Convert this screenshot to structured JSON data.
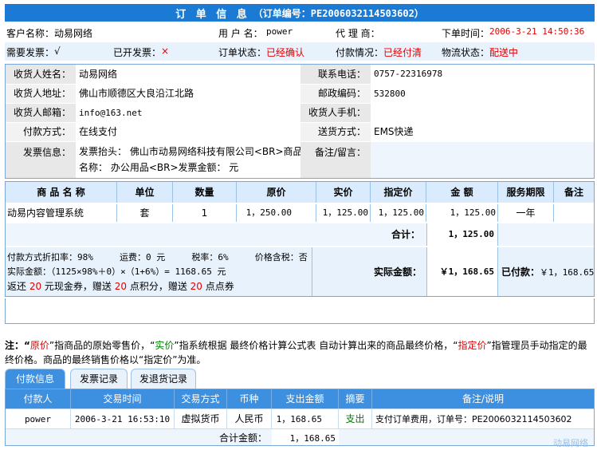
{
  "title": {
    "main": "订 单 信 息",
    "order_no": "（订单编号：PE2006032114503602）"
  },
  "header": {
    "customer_label": "客户名称：",
    "customer": "动易网络",
    "username_label": "用 户 名：",
    "username": "power",
    "agent_label": "代 理 商：",
    "agent": "",
    "time_label": "下单时间：",
    "time": "2006-3-21 14:50:36",
    "invoice_need_label": "需要发票：",
    "invoice_need": "√",
    "invoiced_label": "已开发票：",
    "invoiced": "×",
    "order_status_label": "订单状态：",
    "order_status": "已经确认",
    "payment_label": "付款情况：",
    "payment": "已经付清",
    "logistics_label": "物流状态：",
    "logistics": "配送中"
  },
  "shipping": {
    "name_label": "收货人姓名：",
    "name": "动易网络",
    "phone_label": "联系电话：",
    "phone": "0757-22316978",
    "address_label": "收货人地址：",
    "address": "佛山市顺德区大良沿江北路",
    "zip_label": "邮政编码：",
    "zip": "532800",
    "email_label": "收货人邮箱：",
    "email": "info@163.net",
    "mobile_label": "收货人手机：",
    "mobile": "",
    "pay_method_label": "付款方式：",
    "pay_method": "在线支付",
    "ship_method_label": "送货方式：",
    "ship_method": "EMS快递",
    "invoice_info_label": "发票信息：",
    "invoice_info_1": "发票抬头：  佛山市动易网络科技有限公司<BR>商品",
    "invoice_info_2": "名称：  办公用品<BR>发票金额：  元",
    "remark_label": "备注/留言：",
    "remark": ""
  },
  "products": {
    "headers": [
      "商 品 名 称",
      "单位",
      "数量",
      "原价",
      "实价",
      "指定价",
      "金 额",
      "服务期限",
      "备注"
    ],
    "row": [
      "动易内容管理系统",
      "套",
      "1",
      "1，250.00",
      "1，125.00",
      "1，125.00",
      "1，125.00",
      "一年",
      ""
    ],
    "total_label": "合计：",
    "total": "1，125.00",
    "calc_line1": "付款方式折扣率：98%     运费：0 元     税率：6%     价格含税：否",
    "calc_line2": "实际金额：（1125×98%＋0）×（1+6%）= 1168.65 元",
    "calc_line3_a": "返还 ",
    "calc_line3_b": "20",
    "calc_line3_c": " 元现金券，赠送 ",
    "calc_line3_d": "20",
    "calc_line3_e": " 点积分，赠送 ",
    "calc_line3_f": "20",
    "calc_line3_g": " 点点券",
    "actual_label": "实际金额：",
    "actual": "￥1，168.65",
    "paid_label": "已付款：",
    "paid": "￥1，168.65"
  },
  "note": {
    "a": "注：“",
    "b": "原价",
    "c": "”指商品的原始零售价，“",
    "d": "实价",
    "e": "”指系统根据 最终价格计算公式表 自动计算出来的商品最终价格，“",
    "f": "指定价",
    "g": "”指管理员手动指定的最终价格。商品的最终销售价格以“指定价”为准。"
  },
  "tabs": [
    "付款信息",
    "发票记录",
    "发退货记录"
  ],
  "payments": {
    "headers": [
      "付款人",
      "交易时间",
      "交易方式",
      "币种",
      "支出金额",
      "摘要",
      "备注/说明"
    ],
    "row": [
      "power",
      "2006-3-21 16:53:10",
      "虚拟货币",
      "人民币",
      "1，168.65",
      "支出",
      "支付订单费用，订单号：PE2006032114503602"
    ],
    "total_label": "合计金额：",
    "total": "1，168.65"
  },
  "watermark": "动易网络",
  "colors": {
    "accent": "#1b7ad4",
    "tab_active": "#3d8fe0",
    "alert": "#e00000",
    "green": "#008000"
  }
}
